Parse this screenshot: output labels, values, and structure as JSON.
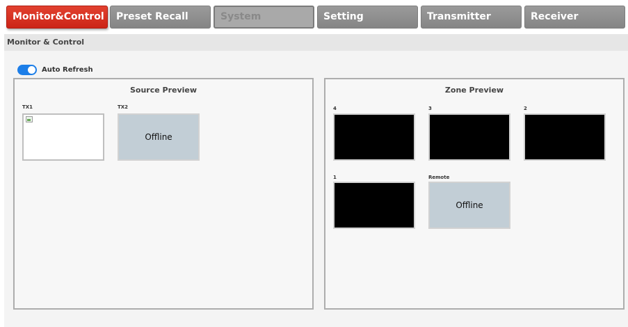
{
  "tabs": [
    {
      "label": "Monitor&Control",
      "state": "active"
    },
    {
      "label": "Preset Recall",
      "state": "normal"
    },
    {
      "label": "System",
      "state": "disabled"
    },
    {
      "label": "Setting",
      "state": "normal"
    },
    {
      "label": "Transmitter",
      "state": "normal"
    },
    {
      "label": "Receiver",
      "state": "normal"
    }
  ],
  "section": {
    "title": "Monitor & Control"
  },
  "auto_refresh": {
    "label": "Auto Refresh",
    "enabled": true
  },
  "source_preview": {
    "title": "Source Preview",
    "items": [
      {
        "label": "TX1",
        "status": "broken-image"
      },
      {
        "label": "TX2",
        "status": "Offline"
      }
    ]
  },
  "zone_preview": {
    "title": "Zone Preview",
    "items": [
      {
        "label": "4",
        "status": "video"
      },
      {
        "label": "3",
        "status": "video"
      },
      {
        "label": "2",
        "status": "video"
      },
      {
        "label": "1",
        "status": "video"
      },
      {
        "label": "Remote",
        "status": "Offline"
      }
    ]
  },
  "colors": {
    "active_tab": "#d8301f",
    "inactive_tab": "#8f8f8f",
    "toggle_on": "#1c7ee8",
    "offline_bg": "#c2ced6"
  }
}
